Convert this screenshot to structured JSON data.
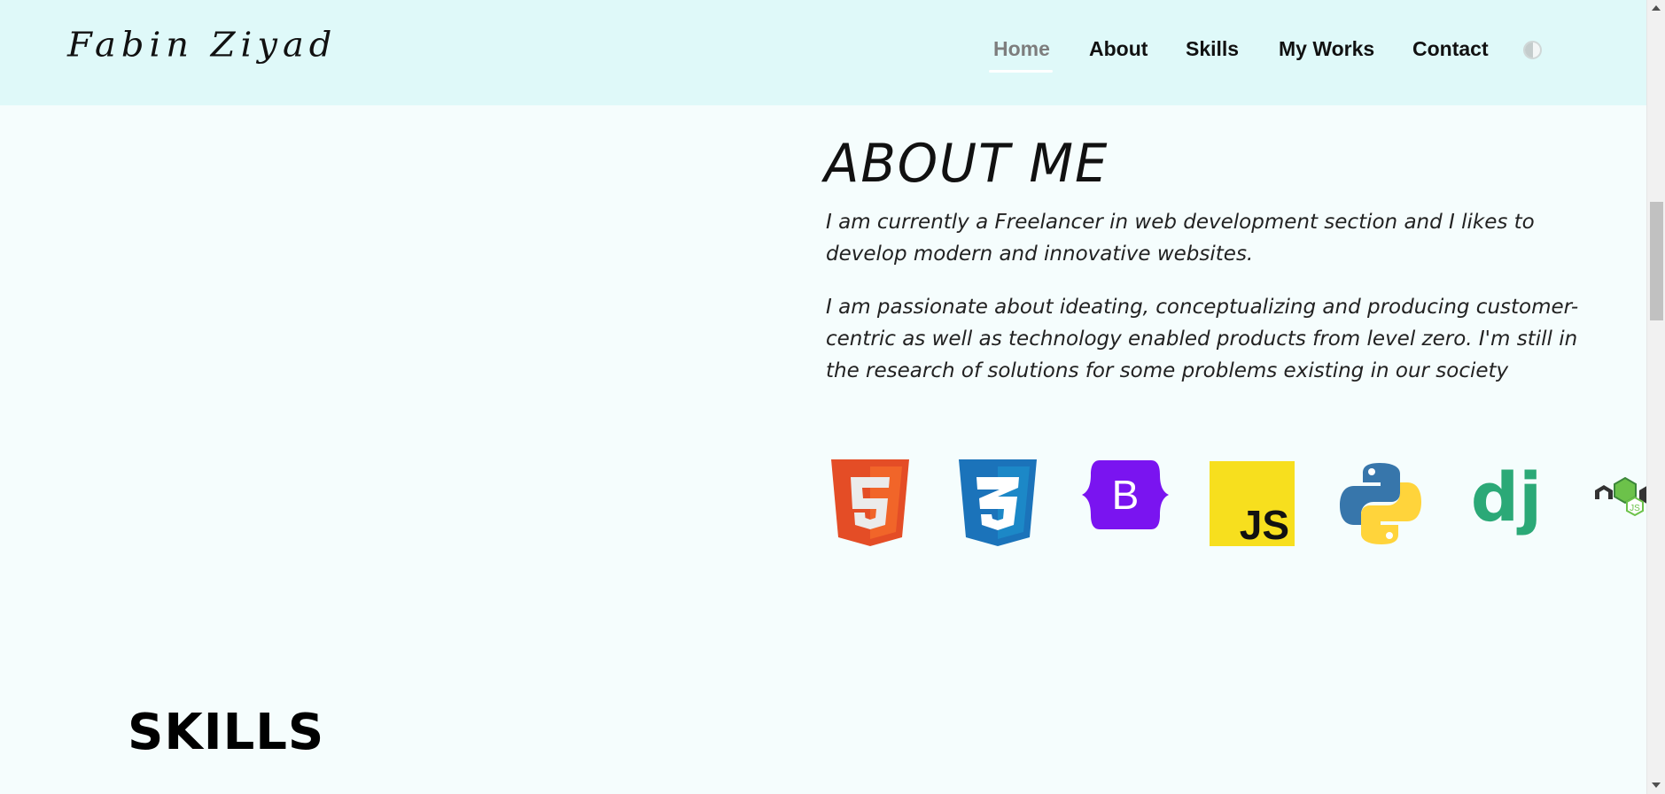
{
  "header": {
    "logo_text": "Fabin Ziyad",
    "nav": [
      {
        "label": "Home",
        "active": true
      },
      {
        "label": "About",
        "active": false
      },
      {
        "label": "Skills",
        "active": false
      },
      {
        "label": "My Works",
        "active": false
      },
      {
        "label": "Contact",
        "active": false
      }
    ],
    "theme_toggle_icon": "contrast-icon",
    "colors": {
      "header_bg": "#dff9f9",
      "active_nav": "#7d7d7d"
    }
  },
  "about": {
    "title": "ABOUT ME",
    "paragraph_1": "I am currently a Freelancer in web development section and I likes to develop modern and innovative websites.",
    "paragraph_2": "I am passionate about ideating, conceptualizing and producing customer-centric as well as technology enabled products from level zero. I'm still in the research of solutions for some problems existing in our society",
    "tech_icons": [
      {
        "name": "html5-icon",
        "label": "5"
      },
      {
        "name": "css3-icon",
        "label": "3"
      },
      {
        "name": "bootstrap-icon",
        "label": "B"
      },
      {
        "name": "javascript-icon",
        "label": "JS"
      },
      {
        "name": "python-icon",
        "label": ""
      },
      {
        "name": "django-icon",
        "label": "dj"
      },
      {
        "name": "nodejs-icon",
        "label": "JS"
      }
    ]
  },
  "skills": {
    "title": "SKILLS"
  },
  "page_bg": "#f5fdfd"
}
